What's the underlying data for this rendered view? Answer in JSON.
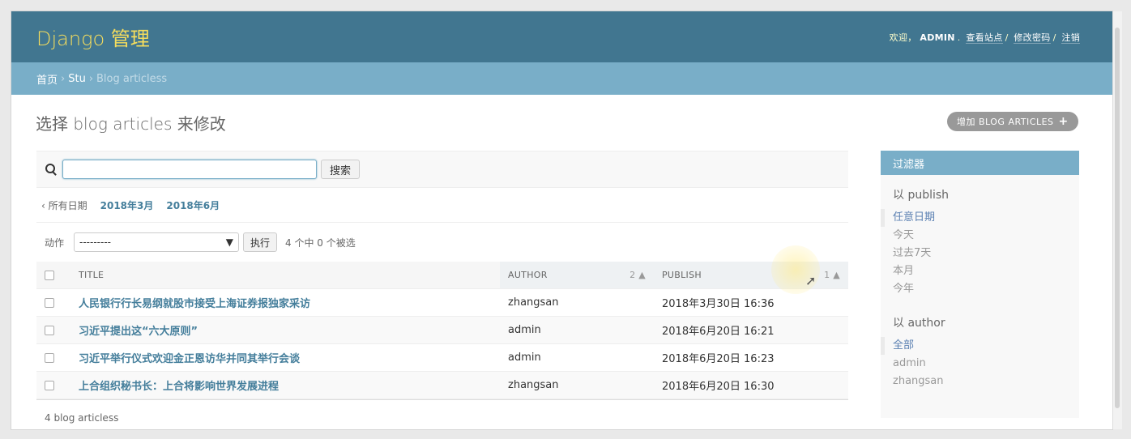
{
  "header": {
    "brand": "Django 管理",
    "welcome": "欢迎，",
    "username": "ADMIN",
    "links": [
      "查看站点",
      "修改密码",
      "注销"
    ]
  },
  "breadcrumbs": [
    "首页",
    "Stu",
    "Blog articless"
  ],
  "page": {
    "title": "选择 blog articles 来修改",
    "add_button": "增加 BLOG ARTICLES"
  },
  "search": {
    "value": "",
    "placeholder": "",
    "button": "搜索"
  },
  "date_hierarchy": {
    "all": "‹ 所有日期",
    "items": [
      "2018年3月",
      "2018年6月"
    ]
  },
  "actions": {
    "label": "动作",
    "select_value": "---------",
    "go": "执行",
    "counter": "4 个中 0 个被选"
  },
  "table": {
    "columns": {
      "title": "TITLE",
      "author": "AUTHOR",
      "author_sort": "2",
      "publish": "PUBLISH",
      "publish_sort": "1"
    },
    "rows": [
      {
        "title": "人民银行行长易纲就股市接受上海证券报独家采访",
        "author": "zhangsan",
        "publish": "2018年3月30日 16:36"
      },
      {
        "title": "习近平提出这“六大原则”",
        "author": "admin",
        "publish": "2018年6月20日 16:21"
      },
      {
        "title": "习近平举行仪式欢迎金正恩访华并同其举行会谈",
        "author": "admin",
        "publish": "2018年6月20日 16:23"
      },
      {
        "title": "上合组织秘书长：上合将影响世界发展进程",
        "author": "zhangsan",
        "publish": "2018年6月20日 16:30"
      }
    ]
  },
  "paginator": "4 blog articless",
  "filter": {
    "title": "过滤器",
    "groups": [
      {
        "heading": "以 publish",
        "options": [
          "任意日期",
          "今天",
          "过去7天",
          "本月",
          "今年"
        ],
        "selected": 0
      },
      {
        "heading": "以 author",
        "options": [
          "全部",
          "admin",
          "zhangsan"
        ],
        "selected": 0
      }
    ]
  },
  "colors": {
    "header_bg": "#417690",
    "breadcrumb_bg": "#79aec8",
    "brand_yellow": "#f5dd5d",
    "link": "#447e9b"
  }
}
